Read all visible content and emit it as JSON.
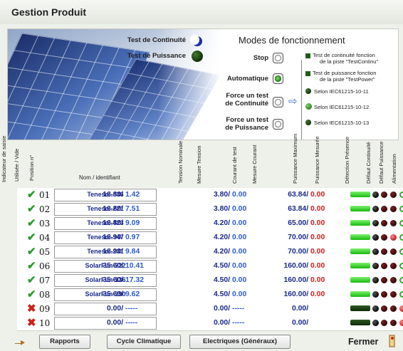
{
  "window": {
    "title": "Gestion Produit"
  },
  "status": {
    "test_continuite": {
      "label": "Test de Continuité",
      "icon": "moon-icon",
      "color": "#1b2fae"
    },
    "test_puissance": {
      "label": "Test de Puissance",
      "state": "off",
      "color": "#0e2a08"
    }
  },
  "modes": {
    "title": "Modes de fonctionnement",
    "options": [
      {
        "label": "Stop",
        "selected": false
      },
      {
        "label": "Automatique",
        "selected": true
      },
      {
        "label_line1": "Force un test",
        "label_line2": "de Continuité",
        "selected": false
      },
      {
        "label_line1": "Force un test",
        "label_line2": "de Puissance",
        "selected": false
      }
    ],
    "descriptions": [
      {
        "line1": "Test de continuité fonction",
        "line2": "de la piste \"TestContinu\"",
        "indicator": "dark-green"
      },
      {
        "line1": "Test de puissance fonction",
        "line2": "de la piste \"TestPower\"",
        "indicator": "dark-green"
      },
      {
        "line1": "Selon IEC61215-10-11",
        "line2": "",
        "indicator": "dark-green"
      },
      {
        "line1": "Selon IEC61215-10-12",
        "line2": "",
        "indicator": "light-green"
      },
      {
        "line1": "Selon IEC61215-10-13",
        "line2": "",
        "indicator": "dark-green"
      }
    ]
  },
  "table": {
    "headers": {
      "indicateur": "Indicateur de saisie",
      "utilisee": "Utilisée / Vide",
      "position": "Position n°",
      "nom": "Nom / identifiant",
      "tension_nominale": "Tension Nominale",
      "mesure_tension": "Mesure Tension",
      "courant_test": "Courant de test",
      "mesure_courant": "Mesure Courant",
      "puissance_max": "Puissance Maximum",
      "puissance_mesuree": "Puissance Mesurée",
      "detection": "Détection Présence",
      "defaut_continuite": "Défaut Continuité",
      "defaut_puissance": "Défaut Puissance",
      "alimentation": "Alimentation"
    },
    "rows": [
      {
        "used": true,
        "pos": "01",
        "name": "Tenesol-836",
        "tension_nom": "16.80",
        "tension_mes": "1.42",
        "courant": "3.80",
        "courant_mes": "0.00",
        "puiss_max": "63.84",
        "puiss_mes": "0.00",
        "presence": true,
        "def_cont": "off",
        "def_puis": "off",
        "alim": "on"
      },
      {
        "used": true,
        "pos": "02",
        "name": "Tenesol-221",
        "tension_nom": "16.80",
        "tension_mes": "7.51",
        "courant": "3.80",
        "courant_mes": "0.00",
        "puiss_max": "63.84",
        "puiss_mes": "0.00",
        "presence": true,
        "def_cont": "off",
        "def_puis": "off",
        "alim": "on"
      },
      {
        "used": true,
        "pos": "03",
        "name": "Tenesol-423",
        "tension_nom": "16.80",
        "tension_mes": "9.09",
        "courant": "4.20",
        "courant_mes": "0.00",
        "puiss_max": "65.00",
        "puiss_mes": "0.00",
        "presence": true,
        "def_cont": "off",
        "def_puis": "off",
        "alim": "on"
      },
      {
        "used": true,
        "pos": "04",
        "name": "Tenesol-347",
        "tension_nom": "16.90",
        "tension_mes": "0.97",
        "courant": "4.20",
        "courant_mes": "0.00",
        "puiss_max": "70.00",
        "puiss_mes": "0.00",
        "presence": true,
        "def_cont": "off",
        "def_puis": "on",
        "alim": "on"
      },
      {
        "used": true,
        "pos": "05",
        "name": "Tenesol-231",
        "tension_nom": "16.90",
        "tension_mes": "9.84",
        "courant": "4.20",
        "courant_mes": "0.00",
        "puiss_max": "70.00",
        "puiss_mes": "0.00",
        "presence": true,
        "def_cont": "off",
        "def_puis": "off",
        "alim": "on"
      },
      {
        "used": true,
        "pos": "06",
        "name": "SolarFun-322",
        "tension_nom": "35.60",
        "tension_mes": "10.41",
        "courant": "4.50",
        "courant_mes": "0.00",
        "puiss_max": "160.00",
        "puiss_mes": "0.00",
        "presence": true,
        "def_cont": "off",
        "def_puis": "off",
        "alim": "on"
      },
      {
        "used": true,
        "pos": "07",
        "name": "SolarFun-136",
        "tension_nom": "35.60",
        "tension_mes": "17.32",
        "courant": "4.50",
        "courant_mes": "0.00",
        "puiss_max": "160.00",
        "puiss_mes": "0.00",
        "presence": true,
        "def_cont": "off",
        "def_puis": "off",
        "alim": "on"
      },
      {
        "used": true,
        "pos": "08",
        "name": "SolarFun-290",
        "tension_nom": "35.60",
        "tension_mes": "9.62",
        "courant": "4.50",
        "courant_mes": "0.00",
        "puiss_max": "160.00",
        "puiss_mes": "0.00",
        "presence": true,
        "def_cont": "off",
        "def_puis": "off",
        "alim": "on"
      },
      {
        "used": false,
        "pos": "09",
        "name": "",
        "tension_nom": "0.00",
        "tension_mes": "-----",
        "courant": "0.00",
        "courant_mes": "-----",
        "puiss_max": "0.00",
        "puiss_mes": "",
        "presence": false,
        "def_cont": "off",
        "def_puis": "off",
        "alim": "red"
      },
      {
        "used": false,
        "pos": "10",
        "name": "",
        "tension_nom": "0.00",
        "tension_mes": "-----",
        "courant": "0.00",
        "courant_mes": "-----",
        "puiss_max": "0.00",
        "puiss_mes": "",
        "presence": false,
        "def_cont": "off",
        "def_puis": "off",
        "alim": "red"
      }
    ]
  },
  "footer": {
    "buttons": [
      "Rapports",
      "Cycle Climatique",
      "Electriques (Généraux)"
    ],
    "fermer": "Fermer"
  },
  "colors": {
    "nominal": "#1a2a8c",
    "measured": "#2a5bd0",
    "alert": "#cc1f1a",
    "ok": "#2e9a2e"
  }
}
